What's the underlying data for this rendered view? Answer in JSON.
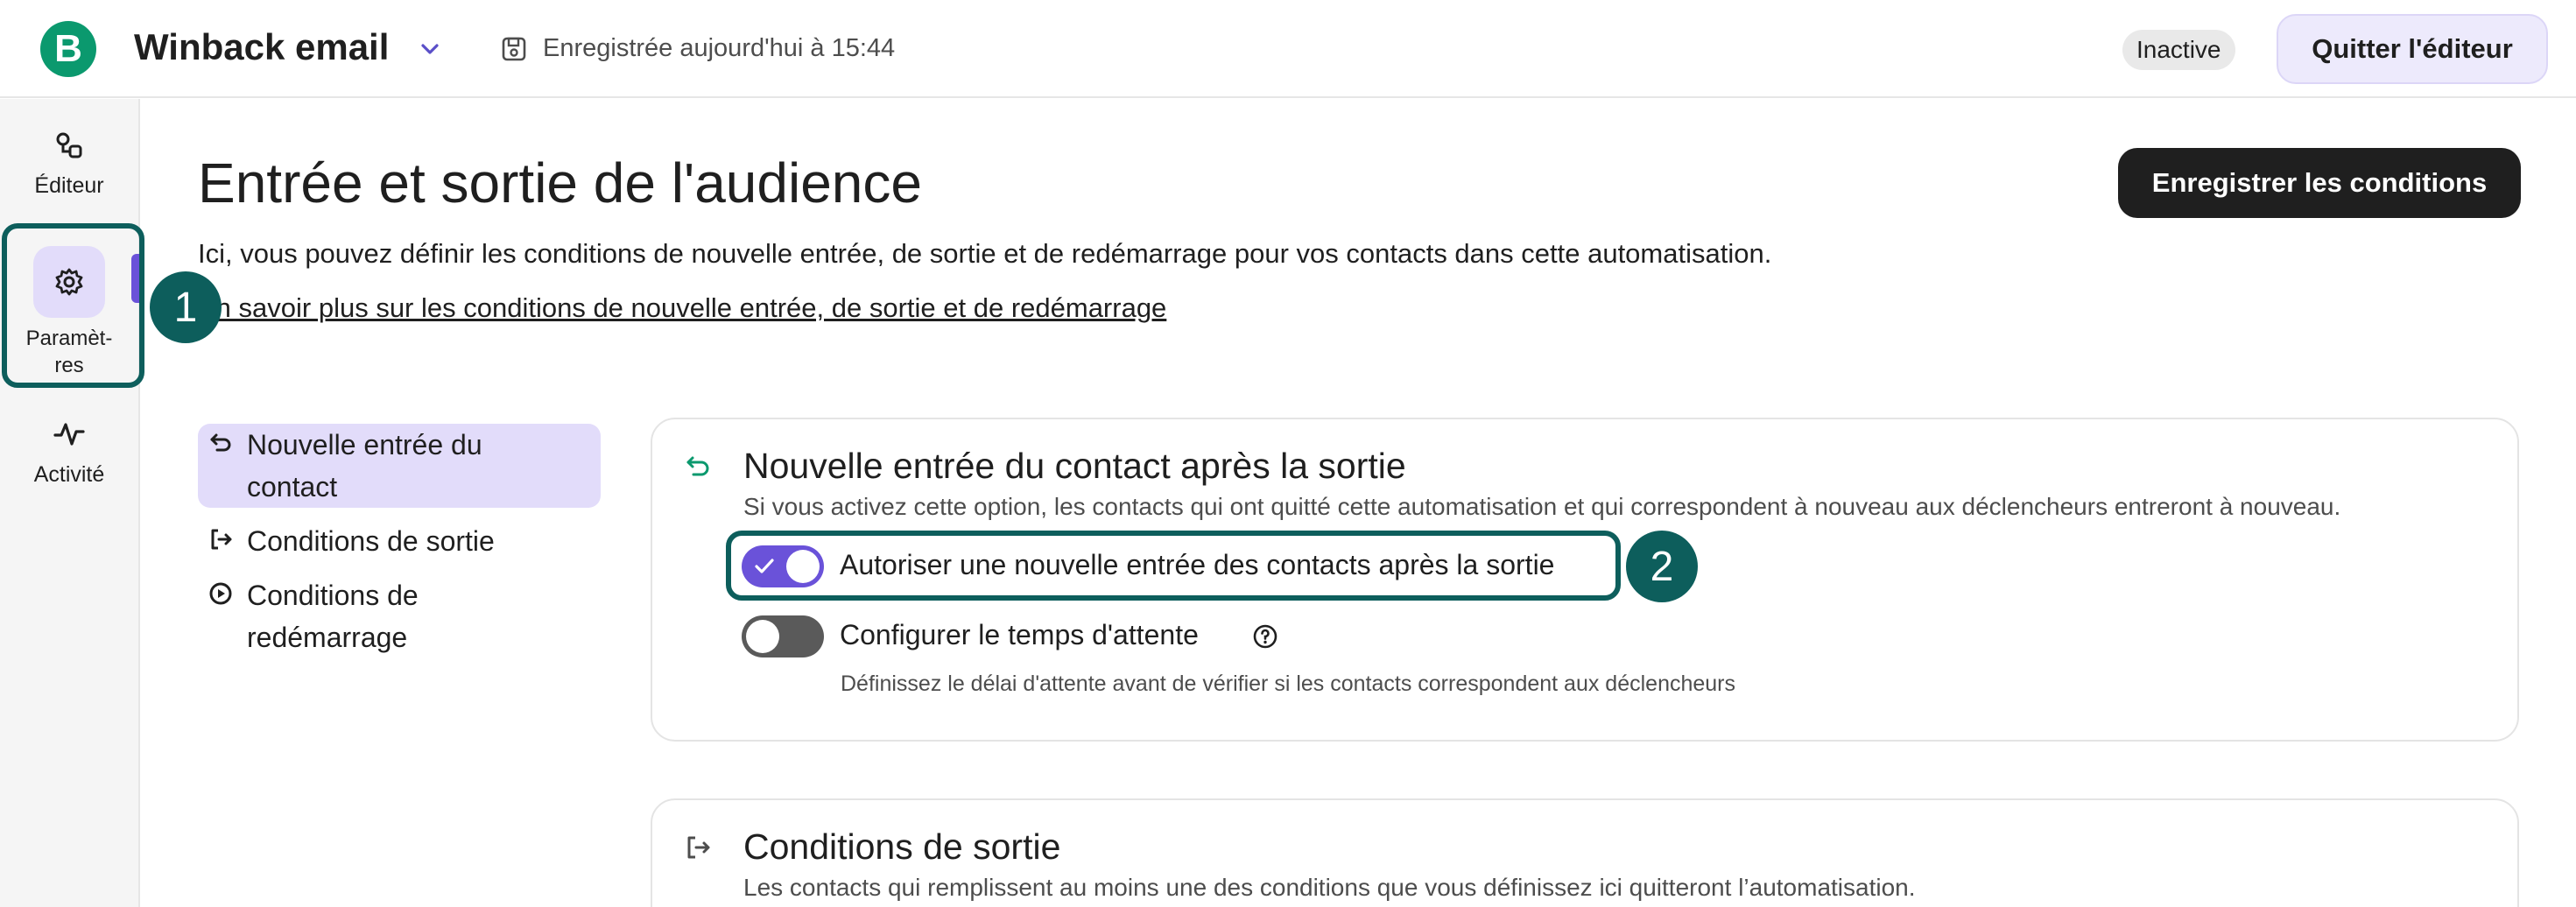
{
  "header": {
    "logo_letter": "B",
    "title": "Winback email",
    "save_status": "Enregistrée aujourd'hui à 15:44",
    "status_badge": "Inactive",
    "quit_label": "Quitter l'éditeur"
  },
  "rail": {
    "editor_label": "Éditeur",
    "settings_label_line1": "Paramèt-",
    "settings_label_line2": "res",
    "activity_label": "Activité"
  },
  "annotations": [
    "1",
    "2"
  ],
  "main": {
    "title": "Entrée et sortie de l'audience",
    "save_button": "Enregistrer les conditions",
    "description": "Ici, vous pouvez définir les conditions de nouvelle entrée, de sortie et de redémarrage pour vos contacts dans cette automatisation.",
    "learn_more": "En savoir plus sur les conditions de nouvelle entrée, de sortie et de redémarrage"
  },
  "subnav": [
    {
      "label": "Nouvelle entrée du contact",
      "icon": "undo-arrow-icon",
      "active": true
    },
    {
      "label": "Conditions de sortie",
      "icon": "exit-icon",
      "active": false
    },
    {
      "label": "Conditions de redémarrage",
      "icon": "play-circle-icon",
      "active": false
    }
  ],
  "card_reentry": {
    "title": "Nouvelle entrée du contact après la sortie",
    "description": "Si vous activez cette option, les contacts qui ont quitté cette automatisation et qui correspondent à nouveau aux déclencheurs entreront à nouveau.",
    "toggle1_label": "Autoriser une nouvelle entrée des contacts après la sortie",
    "toggle1_on": true,
    "toggle2_label": "Configurer le temps d'attente",
    "toggle2_on": false,
    "toggle2_hint": "Définissez le délai d'attente avant de vérifier si les contacts correspondent aux déclencheurs"
  },
  "card_exit": {
    "title": "Conditions de sortie",
    "description": "Les contacts qui remplissent au moins une des conditions que vous définissez ici quitteront l’automatisation."
  },
  "colors": {
    "brand_green": "#0b996e",
    "accent_purple": "#6a52d9",
    "annotation_teal": "#0d5e5c",
    "active_bg": "#e2dcfa"
  }
}
